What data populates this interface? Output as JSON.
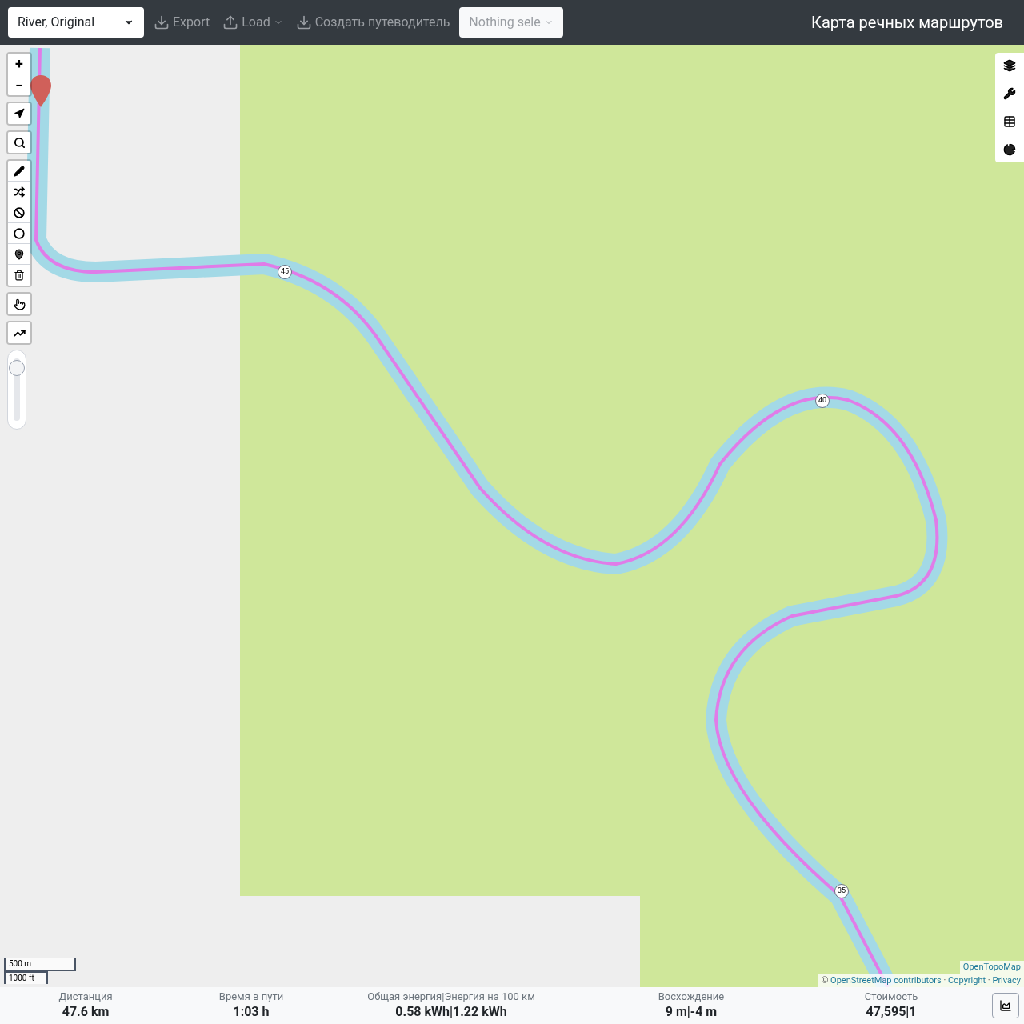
{
  "toolbar": {
    "profile": "River, Original",
    "export": "Export",
    "load": "Load",
    "guide": "Создать путеводитель",
    "selector": "Nothing sele",
    "title": "Карта речных маршрутов"
  },
  "map_controls": {
    "zoom_in": "+",
    "zoom_out": "−",
    "zoom_slider": {
      "level": 0.85
    }
  },
  "route_markers": [
    "45",
    "40",
    "35"
  ],
  "scale": [
    "500 m",
    "1000 ft"
  ],
  "attribution": {
    "layer": "OpenTopoMap",
    "sources": [
      "© ",
      "OpenStreetMap contributors",
      " · ",
      "Copyright",
      " · ",
      "Privacy"
    ]
  },
  "stats": [
    {
      "label": "Дистанция",
      "value": "47.6 km"
    },
    {
      "label": "Время в пути",
      "value": "1:03 h"
    },
    {
      "label": "Общая энергия|Энергия на 100 км",
      "value": "0.58 kWh|1.22 kWh"
    },
    {
      "label": "Восхождение",
      "value": "9 m|-4 m"
    },
    {
      "label": "Стоимость",
      "value": "47,595|1"
    }
  ]
}
